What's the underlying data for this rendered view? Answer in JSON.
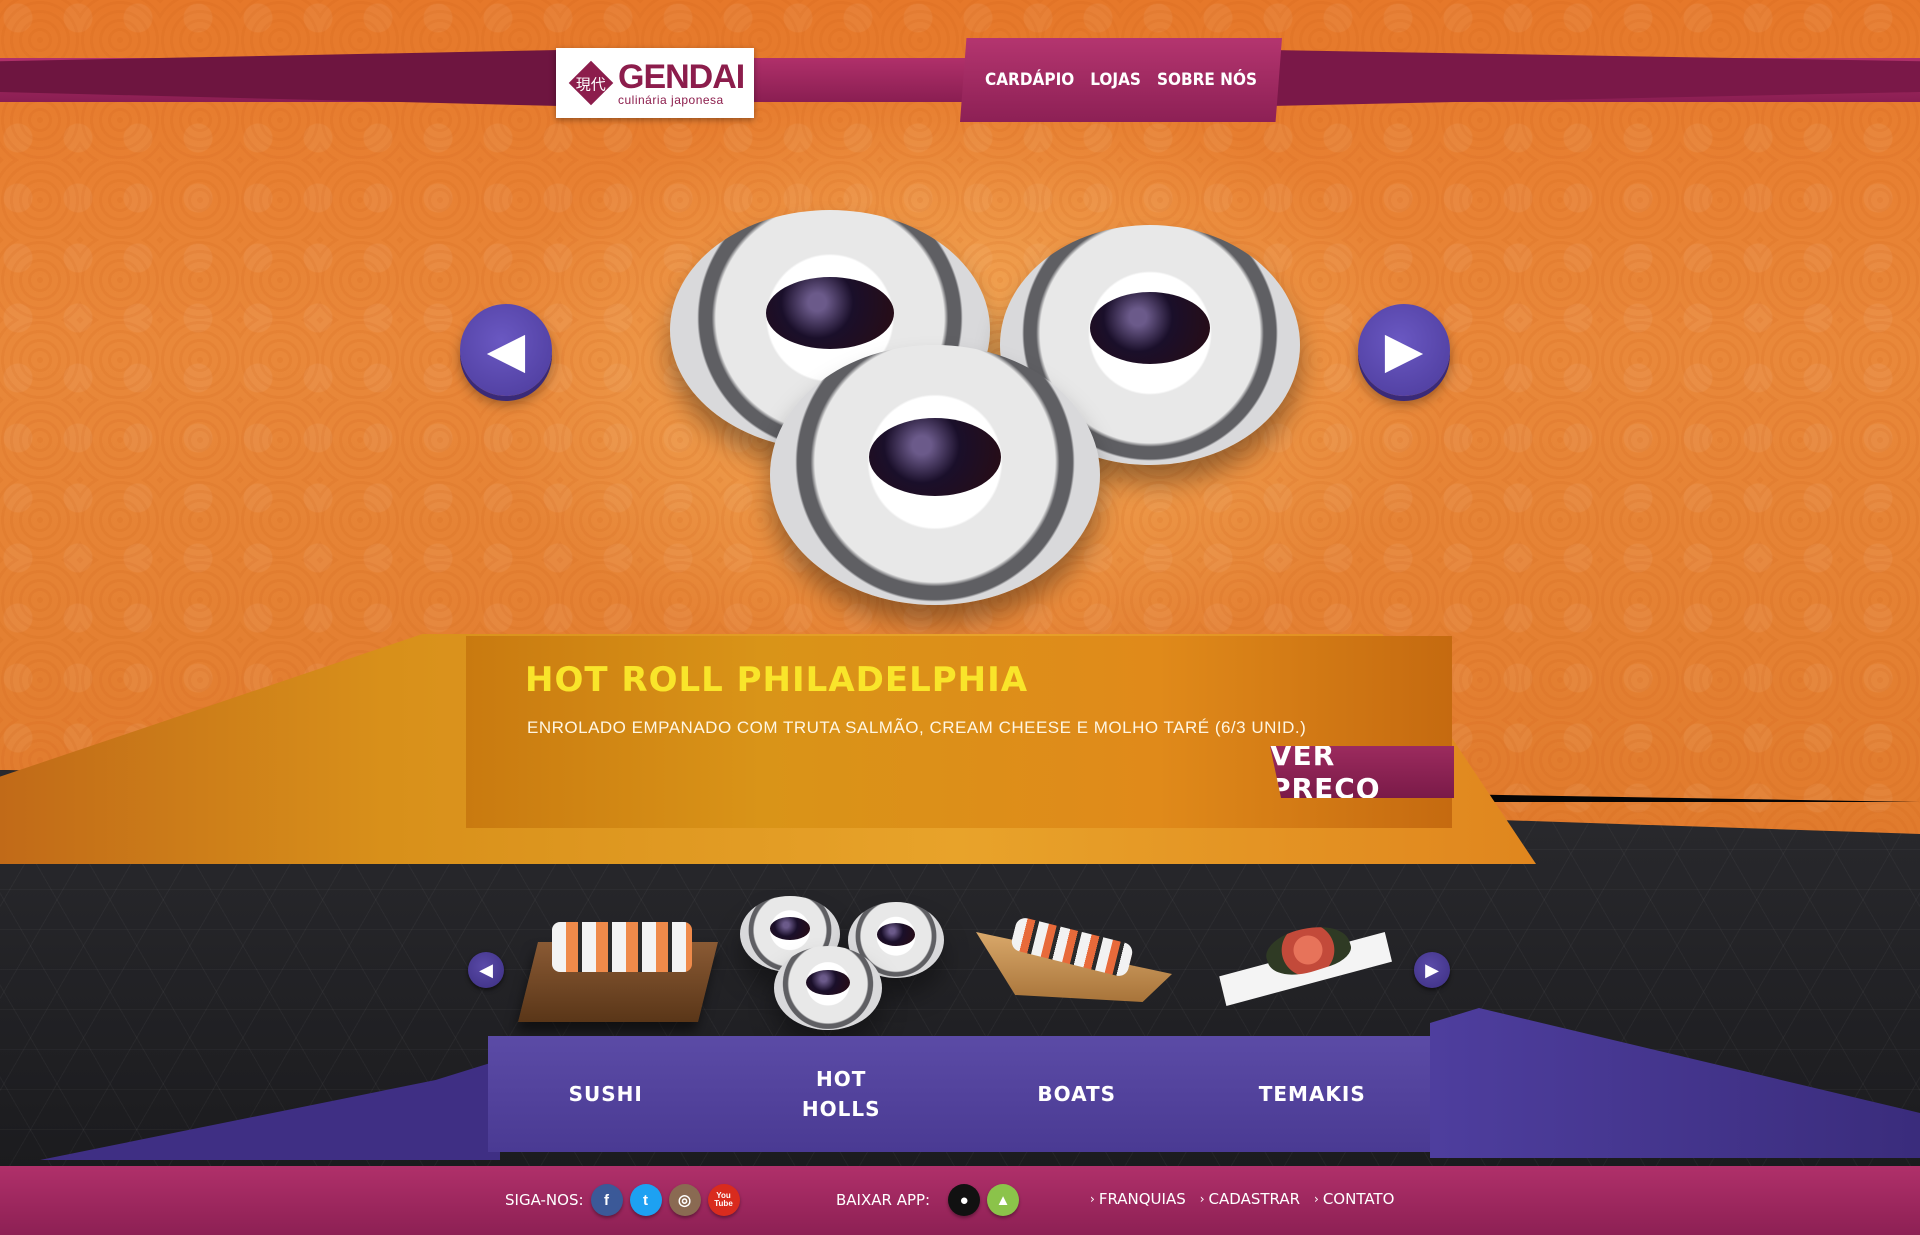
{
  "brand": {
    "name": "GENDAI",
    "subtitle": "culinária japonesa",
    "mark_glyph": "現代"
  },
  "nav": {
    "items": [
      "CARDÁPIO",
      "LOJAS",
      "SOBRE NÓS"
    ]
  },
  "featured": {
    "title": "HOT ROLL PHILADELPHIA",
    "description": "ENROLADO EMPANADO COM TRUTA SALMÃO, CREAM CHEESE E MOLHO TARÉ (6/3 UNID.)",
    "price_button": "VER PREÇO",
    "prev_icon": "chevron-left-icon",
    "next_icon": "chevron-right-icon"
  },
  "categories": {
    "sushi": "SUSHI",
    "hot_line1": "HOT",
    "hot_line2": "HOLLS",
    "boats": "BOATS",
    "temakis": "TEMAKIS"
  },
  "footer": {
    "follow_label": "SIGA-NOS:",
    "app_label": "BAIXAR APP:",
    "links": [
      "FRANQUIAS",
      "CADASTRAR",
      "CONTATO"
    ],
    "social": {
      "facebook": "f",
      "twitter": "t",
      "instagram": "◎",
      "youtube": "You Tube"
    }
  },
  "colors": {
    "accent_magenta": "#8c1d4c",
    "title_yellow": "#f9e52a",
    "button_purple": "#5b4ba6"
  }
}
